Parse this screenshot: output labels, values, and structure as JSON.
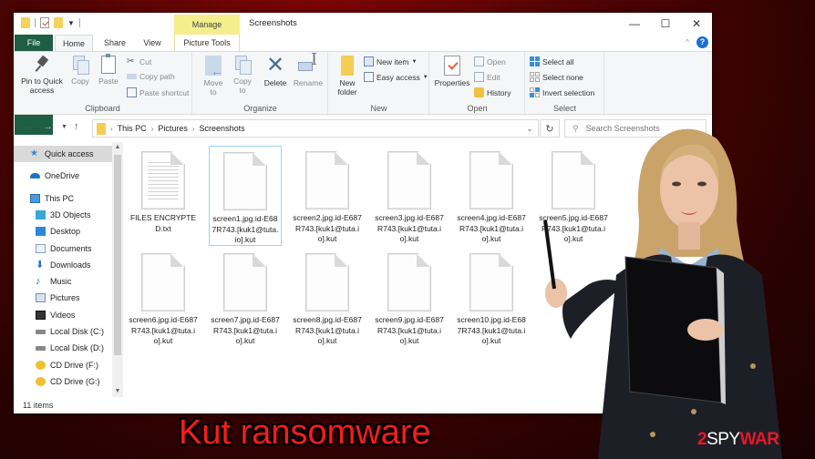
{
  "window": {
    "title": "Screenshots",
    "contextual_tab": "Manage",
    "controls": {
      "minimize": "—",
      "maximize": "☐",
      "close": "✕"
    }
  },
  "ribbon_tabs": [
    {
      "label": "File"
    },
    {
      "label": "Home"
    },
    {
      "label": "Share"
    },
    {
      "label": "View"
    },
    {
      "label": "Picture Tools"
    }
  ],
  "ribbon": {
    "clipboard": {
      "label": "Clipboard",
      "pin": "Pin to Quick access",
      "copy": "Copy",
      "paste": "Paste",
      "cut": "Cut",
      "copy_path": "Copy path",
      "paste_shortcut": "Paste shortcut"
    },
    "organize": {
      "label": "Organize",
      "move_to": "Move to",
      "copy_to": "Copy to",
      "delete": "Delete",
      "rename": "Rename"
    },
    "new": {
      "label": "New",
      "new_folder": "New folder",
      "new_item": "New item",
      "easy_access": "Easy access"
    },
    "open": {
      "label": "Open",
      "properties": "Properties",
      "open": "Open",
      "edit": "Edit",
      "history": "History"
    },
    "select": {
      "label": "Select",
      "select_all": "Select all",
      "select_none": "Select none",
      "invert_selection": "Invert selection"
    }
  },
  "address": {
    "crumbs": [
      "This PC",
      "Pictures",
      "Screenshots"
    ],
    "search_placeholder": "Search Screenshots"
  },
  "nav_pane": [
    {
      "label": "Quick access",
      "icon": "star-icon",
      "selected": true
    },
    {
      "label": "OneDrive",
      "icon": "cloud-icon"
    },
    {
      "label": "This PC",
      "icon": "computer-icon"
    },
    {
      "label": "3D Objects",
      "icon": "cube-icon"
    },
    {
      "label": "Desktop",
      "icon": "desktop-icon"
    },
    {
      "label": "Documents",
      "icon": "document-icon"
    },
    {
      "label": "Downloads",
      "icon": "download-icon"
    },
    {
      "label": "Music",
      "icon": "music-icon"
    },
    {
      "label": "Pictures",
      "icon": "pictures-icon"
    },
    {
      "label": "Videos",
      "icon": "video-icon"
    },
    {
      "label": "Local Disk (C:)",
      "icon": "disk-icon"
    },
    {
      "label": "Local Disk (D:)",
      "icon": "disk-icon"
    },
    {
      "label": "CD Drive (F:)",
      "icon": "cd-icon"
    },
    {
      "label": "CD Drive (G:)",
      "icon": "cd-icon"
    }
  ],
  "status": "11 items",
  "files": [
    {
      "name": "FILES ENCRYPTED.txt",
      "type": "txt"
    },
    {
      "name": "screen1.jpg.id-E687R743.[kuk1@tuta.io].kut",
      "selected": true
    },
    {
      "name": "screen2.jpg.id-E687R743.[kuk1@tuta.io].kut"
    },
    {
      "name": "screen3.jpg.id-E687R743.[kuk1@tuta.io].kut"
    },
    {
      "name": "screen4.jpg.id-E687R743.[kuk1@tuta.io].kut"
    },
    {
      "name": "screen5.jpg.id-E687R743.[kuk1@tuta.io].kut"
    },
    {
      "name": "screen6.jpg.id-E687R743.[kuk1@tuta.io].kut"
    },
    {
      "name": "screen7.jpg.id-E687R743.[kuk1@tuta.io].kut"
    },
    {
      "name": "screen8.jpg.id-E687R743.[kuk1@tuta.io].kut"
    },
    {
      "name": "screen9.jpg.id-E687R743.[kuk1@tuta.io].kut"
    },
    {
      "name": "screen10.jpg.id-E687R743.[kuk1@tuta.io].kut"
    }
  ],
  "caption": "Kut ransomware",
  "logo": {
    "part1": "2",
    "part2": "SPY",
    "part3": "WAR"
  },
  "colors": {
    "accent_red": "#ff1b1b",
    "file_tab": "#1e5e44",
    "manage_tab": "#f4ee8c",
    "selection_border": "#99d1ff"
  }
}
